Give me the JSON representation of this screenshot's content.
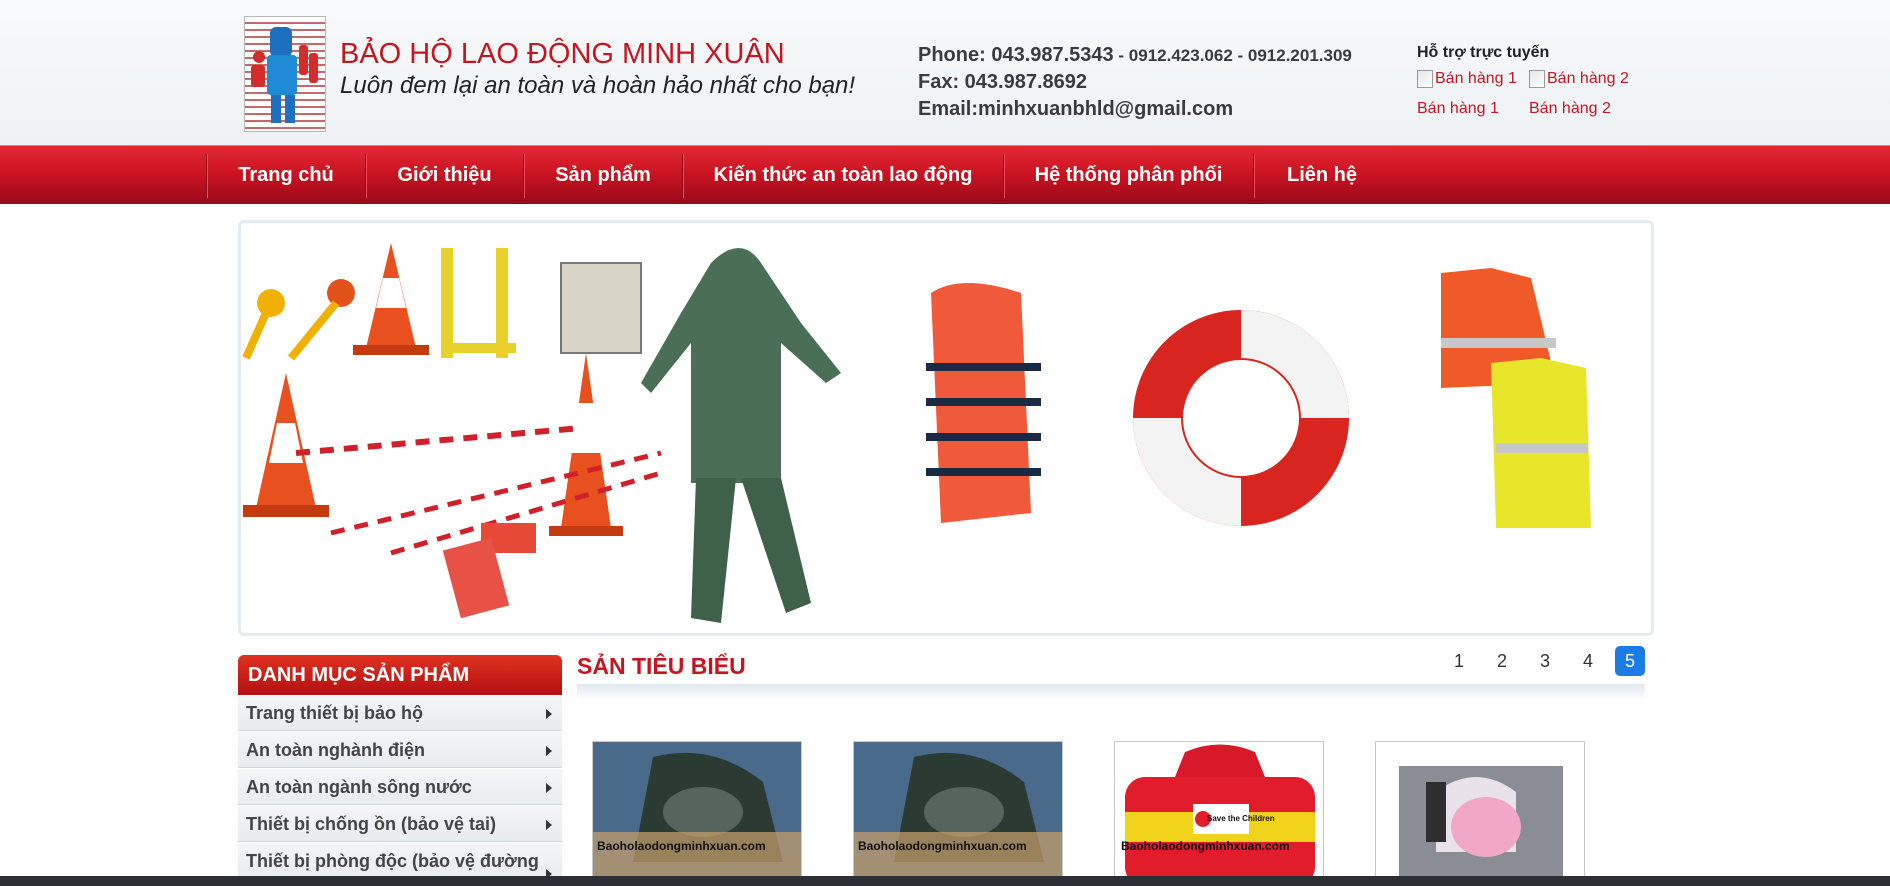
{
  "header": {
    "brand_name": "BẢO HỘ LAO ĐỘNG MINH XUÂN",
    "slogan": "Luôn đem lại an toàn và hoàn hảo nhất cho bạn!",
    "phone_label": "Phone: 043.987.5343",
    "phone_extra": " - 0912.423.062 - 0912.201.309",
    "fax": "Fax: 043.987.8692",
    "email": "Email:minhxuanbhld@gmail.com",
    "support_title": "Hỗ trợ trực tuyến",
    "sales": [
      {
        "image_alt": "Bán hàng 1",
        "label": "Bán hàng 1"
      },
      {
        "image_alt": "Bán hàng 2",
        "label": "Bán hàng 2"
      }
    ]
  },
  "nav": {
    "items": [
      "Trang chủ",
      "Giới thiệu",
      "Sản phẩm",
      "Kiến thức an toàn lao động",
      "Hệ thống phân phối",
      "Liên hệ"
    ]
  },
  "sidebar": {
    "title": "DANH MỤC SẢN PHẨM",
    "items": [
      "Trang thiết bị bảo hộ",
      "An toàn nghành điện",
      "An toàn ngành sông nước",
      "Thiết bị chống ồn (bảo vệ tai)",
      "Thiết bị phòng độc (bảo vệ đường"
    ]
  },
  "featured": {
    "title": "SẢN TIÊU BIỂU",
    "pages": [
      "1",
      "2",
      "3",
      "4",
      "5"
    ],
    "active_page": "5",
    "watermarks": [
      "Baoholaodongminhxuan.com",
      "Baoholaodongminhxuan.com",
      "Baoholaodongminhxuan.com"
    ],
    "bag_badge": "Save the Children"
  },
  "colors": {
    "brand_red": "#c41620",
    "nav_red": "#cc1422",
    "active_page_blue": "#1c7ce6"
  }
}
